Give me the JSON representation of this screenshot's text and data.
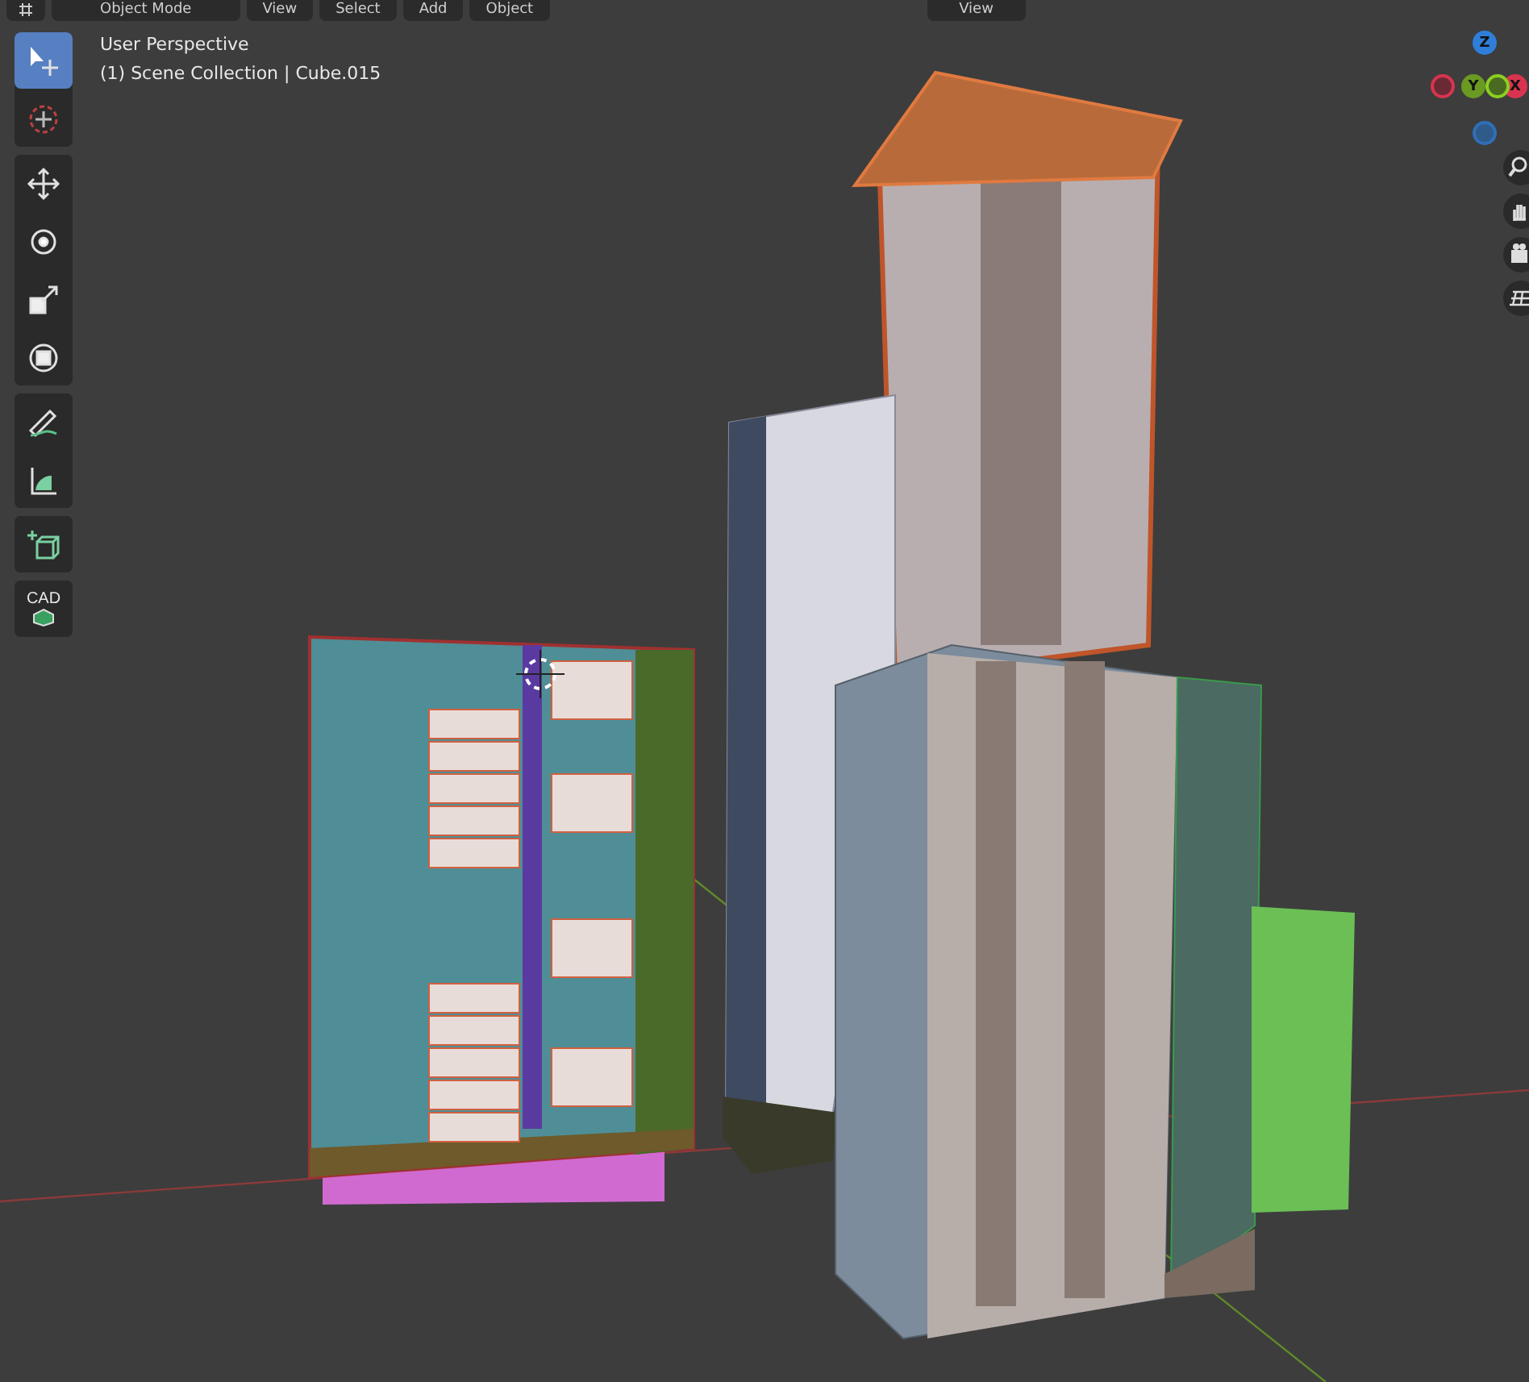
{
  "header": {
    "mode_menu": "Object Mode",
    "menus": [
      "View",
      "Select",
      "Add",
      "Object"
    ],
    "view_menu": "View"
  },
  "viewport": {
    "title": "User Perspective",
    "subtitle": "(1) Scene Collection | Cube.015"
  },
  "toolbar": [
    {
      "tools": [
        {
          "kind": "select",
          "selected": true
        },
        {
          "kind": "cursor",
          "selected": false
        }
      ]
    },
    {
      "tools": [
        {
          "kind": "move",
          "selected": false
        },
        {
          "kind": "rotate",
          "selected": false
        },
        {
          "kind": "scale",
          "selected": false
        },
        {
          "kind": "transform",
          "selected": false
        }
      ]
    },
    {
      "tools": [
        {
          "kind": "annotate",
          "selected": false
        },
        {
          "kind": "measure",
          "selected": false
        }
      ]
    },
    {
      "tools": [
        {
          "kind": "add-cube",
          "selected": false
        }
      ]
    },
    {
      "tools": [
        {
          "kind": "cad",
          "selected": false,
          "label": "CAD"
        }
      ]
    }
  ],
  "gizmo": {
    "axes": [
      {
        "label": "Z",
        "color": "#2f7fd8"
      },
      {
        "label": "Y",
        "color": "#6a9a22"
      },
      {
        "label": "X",
        "color": "#d8344f"
      }
    ]
  }
}
